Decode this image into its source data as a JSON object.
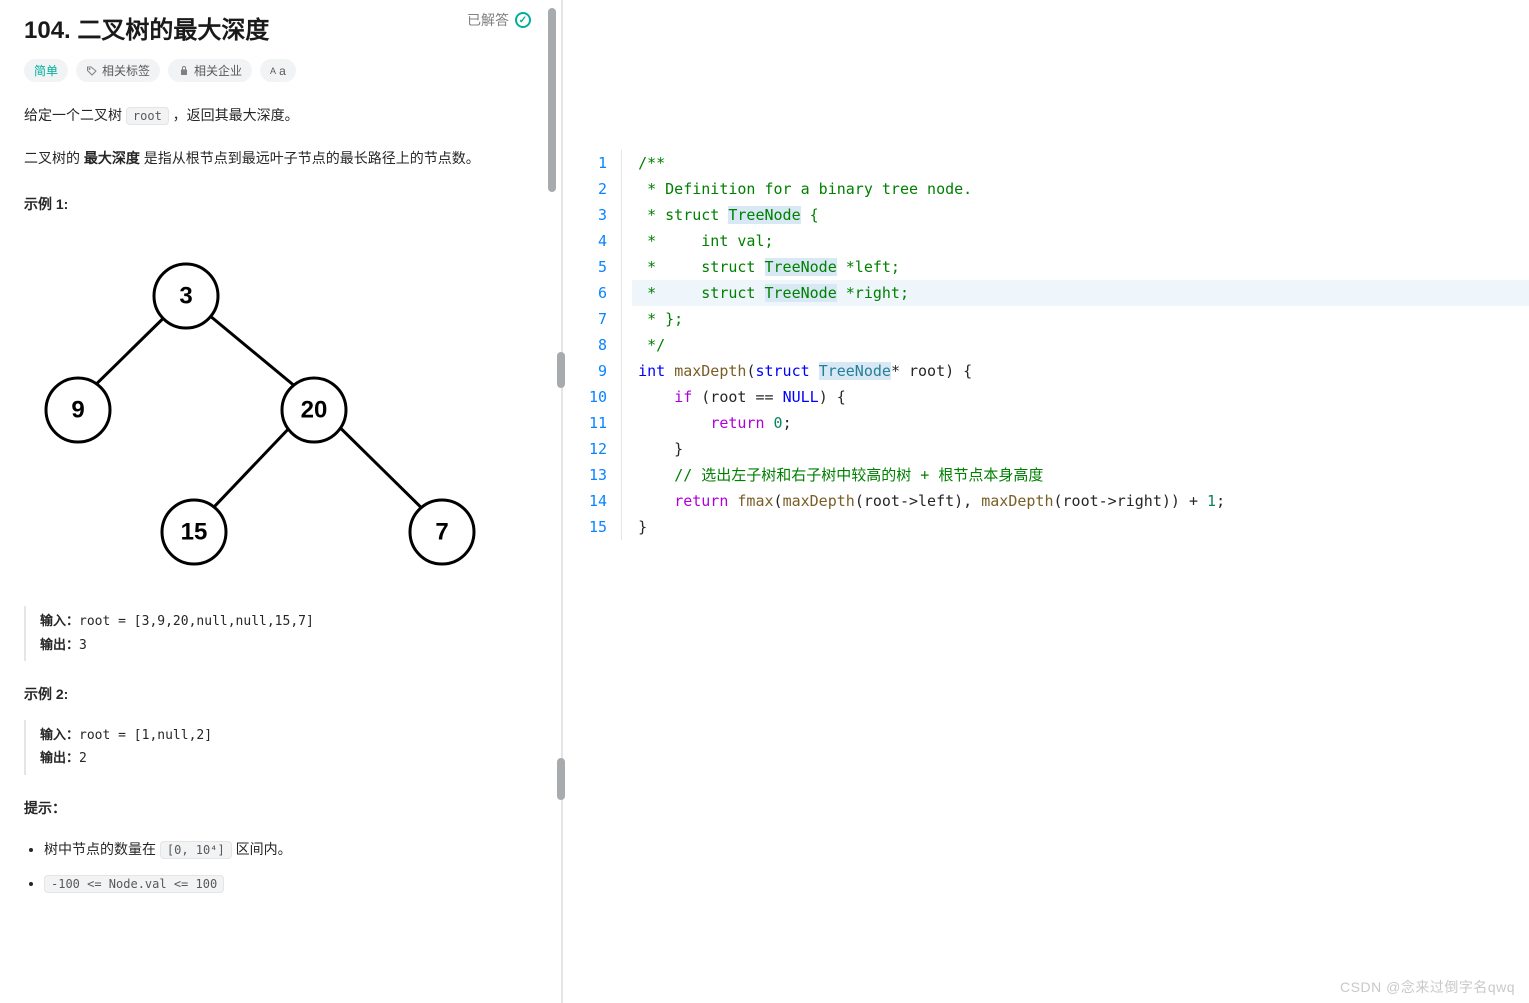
{
  "problem": {
    "title": "104. 二叉树的最大深度",
    "status_label": "已解答",
    "tags": {
      "difficulty": "简单",
      "related_tags": "相关标签",
      "companies": "相关企业",
      "fontsize": "A"
    },
    "desc_line1_pre": "给定一个二叉树 ",
    "desc_line1_code": "root",
    "desc_line1_post": " ，返回其最大深度。",
    "desc_line2_pre": "二叉树的 ",
    "desc_line2_bold": "最大深度",
    "desc_line2_post": " 是指从根节点到最远叶子节点的最长路径上的节点数。",
    "example1_title": "示例 1:",
    "example1_input_label": "输入：",
    "example1_input_value": "root = [3,9,20,null,null,15,7]",
    "example1_output_label": "输出：",
    "example1_output_value": "3",
    "example2_title": "示例 2:",
    "example2_input_label": "输入：",
    "example2_input_value": "root = [1,null,2]",
    "example2_output_label": "输出：",
    "example2_output_value": "2",
    "hints_title": "提示：",
    "hint1_pre": "树中节点的数量在 ",
    "hint1_code": "[0, 10⁴]",
    "hint1_post": " 区间内。",
    "hint2_code": "-100 <= Node.val <= 100",
    "tree_nodes": {
      "root": "3",
      "l": "9",
      "r": "20",
      "rl": "15",
      "rr": "7"
    }
  },
  "code": {
    "line_numbers": [
      "1",
      "2",
      "3",
      "4",
      "5",
      "6",
      "7",
      "8",
      "9",
      "10",
      "11",
      "12",
      "13",
      "14",
      "15"
    ],
    "l1": "/**",
    "l2_a": " * Definition for a binary tree node.",
    "l3_a": " * struct ",
    "l3_b": "TreeNode",
    "l3_c": " {",
    "l4_a": " *     int val;",
    "l5_a": " *     struct ",
    "l5_b": "TreeNode",
    "l5_c": " *left;",
    "l6_a": " *     struct ",
    "l6_b": "TreeNode",
    "l6_c": " *right;",
    "l7_a": " * };",
    "l8_a": " */",
    "l9_a": "int",
    "l9_b": " ",
    "l9_c": "maxDepth",
    "l9_d": "(",
    "l9_e": "struct",
    "l9_f": " ",
    "l9_g": "TreeNode",
    "l9_h": "* root) {",
    "l10_a": "    ",
    "l10_b": "if",
    "l10_c": " (root == ",
    "l10_d": "NULL",
    "l10_e": ") {",
    "l11_a": "        ",
    "l11_b": "return",
    "l11_c": " ",
    "l11_d": "0",
    "l11_e": ";",
    "l12_a": "    }",
    "l13_a": "    ",
    "l13_b": "// 选出左子树和右子树中较高的树 + 根节点本身高度",
    "l14_a": "    ",
    "l14_b": "return",
    "l14_c": " ",
    "l14_d": "fmax",
    "l14_e": "(",
    "l14_f": "maxDepth",
    "l14_g": "(root->left), ",
    "l14_h": "maxDepth",
    "l14_i": "(root->right)) + ",
    "l14_j": "1",
    "l14_k": ";",
    "l15_a": "}"
  },
  "watermark": "CSDN @念来过倒字名qwq"
}
